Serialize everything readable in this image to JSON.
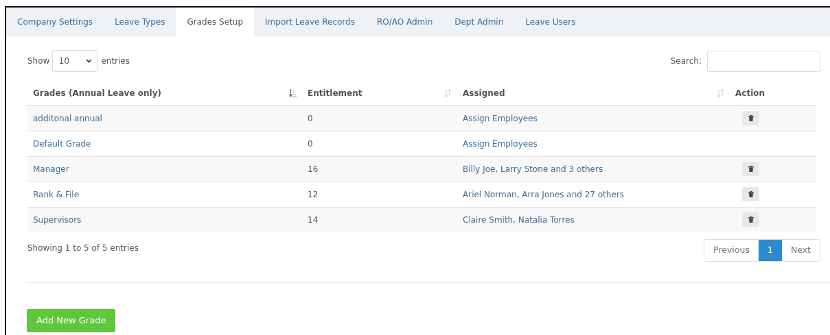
{
  "tabs": [
    {
      "label": "Company Settings",
      "selected": false
    },
    {
      "label": "Leave Types",
      "selected": false
    },
    {
      "label": "Grades Setup",
      "selected": true
    },
    {
      "label": "Import Leave Records",
      "selected": false
    },
    {
      "label": "RO/AO Admin",
      "selected": false
    },
    {
      "label": "Dept Admin",
      "selected": false
    },
    {
      "label": "Leave Users",
      "selected": false
    }
  ],
  "length_menu": {
    "show_label": "Show",
    "value": "10",
    "entries_label": "entries"
  },
  "search": {
    "label": "Search:"
  },
  "table": {
    "columns": [
      {
        "label": "Grades (Annual Leave only)",
        "sortable": true,
        "sorted": true
      },
      {
        "label": "Entitlement",
        "sortable": true,
        "sorted": false
      },
      {
        "label": "Assigned",
        "sortable": true,
        "sorted": false
      },
      {
        "label": "Action",
        "sortable": false
      }
    ],
    "rows": [
      {
        "grade": "additonal annual",
        "entitlement": "0",
        "assigned": "Assign Employees",
        "deletable": true
      },
      {
        "grade": "Default Grade",
        "entitlement": "0",
        "assigned": "Assign Employees",
        "deletable": false
      },
      {
        "grade": "Manager",
        "entitlement": "16",
        "assigned": "Billy Joe, Larry Stone and 3 others",
        "deletable": true
      },
      {
        "grade": "Rank & File",
        "entitlement": "12",
        "assigned": "Ariel Norman, Arra Jones and 27 others",
        "deletable": true
      },
      {
        "grade": "Supervisors",
        "entitlement": "14",
        "assigned": "Claire Smith, Natalia Torres",
        "deletable": true
      }
    ]
  },
  "info": "Showing 1 to 5 of 5 entries",
  "pagination": [
    {
      "label": "Previous",
      "selected": false
    },
    {
      "label": "1",
      "selected": true
    },
    {
      "label": "Next",
      "selected": false
    }
  ],
  "add_button": "Add New Grade"
}
